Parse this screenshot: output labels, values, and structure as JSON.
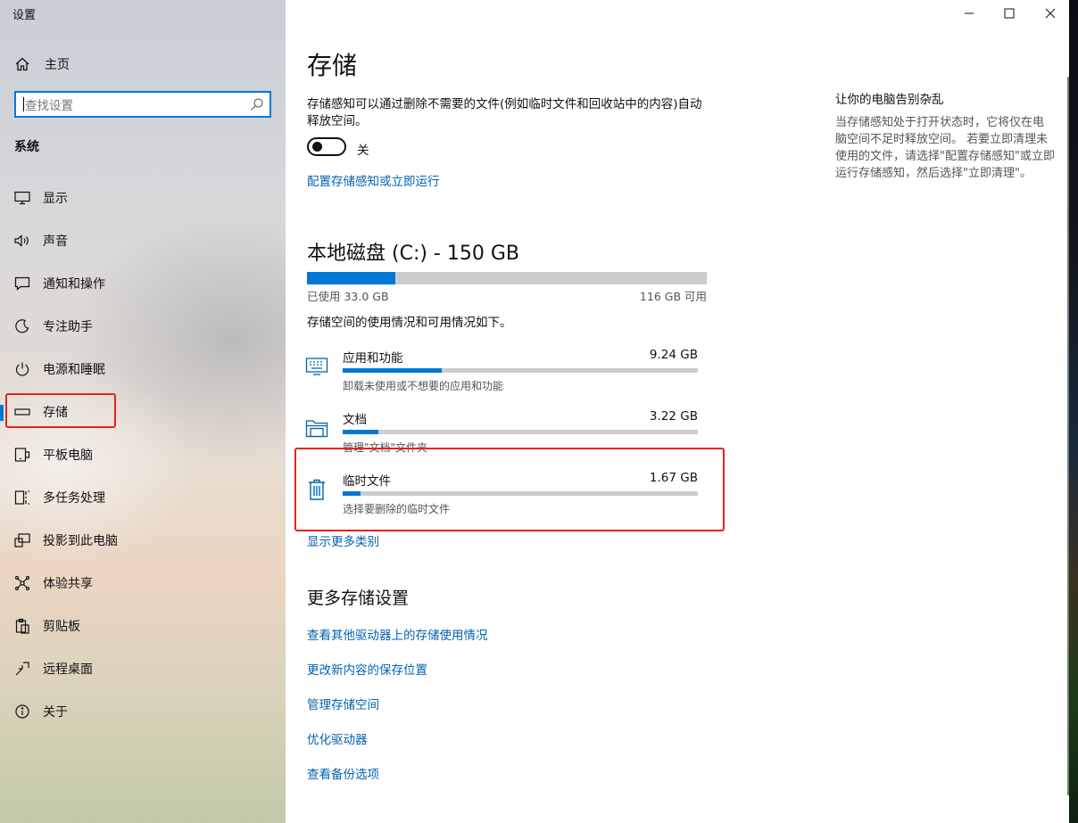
{
  "window": {
    "title": "设置"
  },
  "sidebar": {
    "home_label": "主页",
    "search_placeholder": "查找设置",
    "section_label": "系统",
    "items": [
      {
        "label": "显示",
        "icon": "monitor-icon"
      },
      {
        "label": "声音",
        "icon": "speaker-icon"
      },
      {
        "label": "通知和操作",
        "icon": "notification-icon"
      },
      {
        "label": "专注助手",
        "icon": "focus-assist-icon"
      },
      {
        "label": "电源和睡眠",
        "icon": "power-icon"
      },
      {
        "label": "存储",
        "icon": "storage-icon",
        "active": true
      },
      {
        "label": "平板电脑",
        "icon": "tablet-icon"
      },
      {
        "label": "多任务处理",
        "icon": "multitasking-icon"
      },
      {
        "label": "投影到此电脑",
        "icon": "projecting-icon"
      },
      {
        "label": "体验共享",
        "icon": "shared-experiences-icon"
      },
      {
        "label": "剪贴板",
        "icon": "clipboard-icon"
      },
      {
        "label": "远程桌面",
        "icon": "remote-desktop-icon"
      },
      {
        "label": "关于",
        "icon": "info-icon"
      }
    ]
  },
  "main": {
    "title": "存储",
    "storage_sense": {
      "description": "存储感知可以通过删除不需要的文件(例如临时文件和回收站中的内容)自动释放空间。",
      "toggle_state": "关",
      "toggle_on": false,
      "configure_link": "配置存储感知或立即运行"
    },
    "disk": {
      "title": "本地磁盘 (C:) - 150 GB",
      "used_label": "已使用 33.0 GB",
      "free_label": "116 GB 可用",
      "used_fraction": 0.22,
      "summary": "存储空间的使用情况和可用情况如下。",
      "categories": [
        {
          "name": "应用和功能",
          "size": "9.24 GB",
          "desc": "卸载未使用或不想要的应用和功能",
          "fraction": 0.28,
          "icon": "apps-features-icon"
        },
        {
          "name": "文档",
          "size": "3.22 GB",
          "desc": "管理\"文档\"文件夹",
          "fraction": 0.1,
          "icon": "documents-folder-icon"
        },
        {
          "name": "临时文件",
          "size": "1.67 GB",
          "desc": "选择要删除的临时文件",
          "fraction": 0.05,
          "icon": "trash-icon"
        }
      ],
      "show_more_link": "显示更多类别"
    },
    "more_settings": {
      "title": "更多存储设置",
      "links": [
        "查看其他驱动器上的存储使用情况",
        "更改新内容的保存位置",
        "管理存储空间",
        "优化驱动器",
        "查看备份选项"
      ]
    },
    "tip": {
      "title": "让你的电脑告别杂乱",
      "text": "当存储感知处于打开状态时，它将仅在电脑空间不足时释放空间。 若要立即清理未使用的文件，请选择\"配置存储感知\"或立即运行存储感知，然后选择\"立即清理\"。"
    }
  },
  "colors": {
    "accent": "#0078d7",
    "link": "#0063b1",
    "highlight_box": "#e3241b"
  }
}
